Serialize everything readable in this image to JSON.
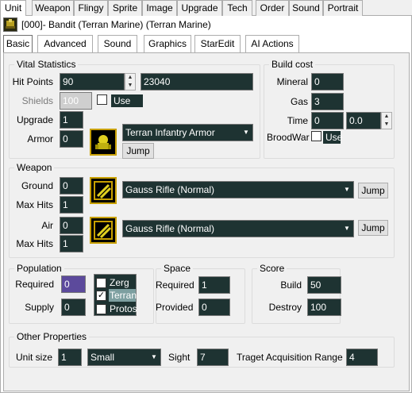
{
  "top_tabs": [
    "Unit",
    "Weapon",
    "Flingy",
    "Sprite",
    "Image",
    "Upgrade",
    "Tech",
    "Order",
    "Sound",
    "Portrait"
  ],
  "unit_title": "[000]- Bandit (Terran Marine) (Terran Marine)",
  "sub_tabs": [
    "Basic",
    "Advanced",
    "Sound",
    "Graphics",
    "StarEdit",
    "AI Actions"
  ],
  "vital": {
    "title": "Vital Statistics",
    "hit_points_label": "Hit Points",
    "hit_points": "90",
    "hit_points_raw": "23040",
    "shields_label": "Shields",
    "shields": "100",
    "use_label": "Use",
    "upgrade_label": "Upgrade",
    "upgrade": "1",
    "armor_label": "Armor",
    "armor": "0",
    "armor_type": "Terran Infantry Armor",
    "jump_label": "Jump"
  },
  "build": {
    "title": "Build cost",
    "mineral_label": "Mineral",
    "mineral": "0",
    "gas_label": "Gas",
    "gas": "3",
    "time_label": "Time",
    "time": "0",
    "time_sec": "0.0",
    "broodwar_label": "BroodWar",
    "use_label": "Use"
  },
  "weapon": {
    "title": "Weapon",
    "ground_label": "Ground",
    "ground": "0",
    "maxhits_label": "Max Hits",
    "ground_maxhits": "1",
    "ground_weapon": "Gauss Rifle (Normal)",
    "air_label": "Air",
    "air": "0",
    "air_maxhits": "1",
    "air_weapon": "Gauss Rifle (Normal)",
    "jump_label": "Jump"
  },
  "population": {
    "title": "Population",
    "required_label": "Required",
    "required": "0",
    "supply_label": "Supply",
    "supply": "0",
    "races": [
      "Zerg",
      "Terran",
      "Protos"
    ]
  },
  "space": {
    "title": "Space",
    "required_label": "Required",
    "required": "1",
    "provided_label": "Provided",
    "provided": "0"
  },
  "score": {
    "title": "Score",
    "build_label": "Build",
    "build": "50",
    "destroy_label": "Destroy",
    "destroy": "100"
  },
  "other": {
    "title": "Other Properties",
    "unit_size_label": "Unit size",
    "unit_size": "1",
    "unit_size_name": "Small",
    "sight_label": "Sight",
    "sight": "7",
    "target_label": "Traget Acquisition Range",
    "target": "4"
  }
}
